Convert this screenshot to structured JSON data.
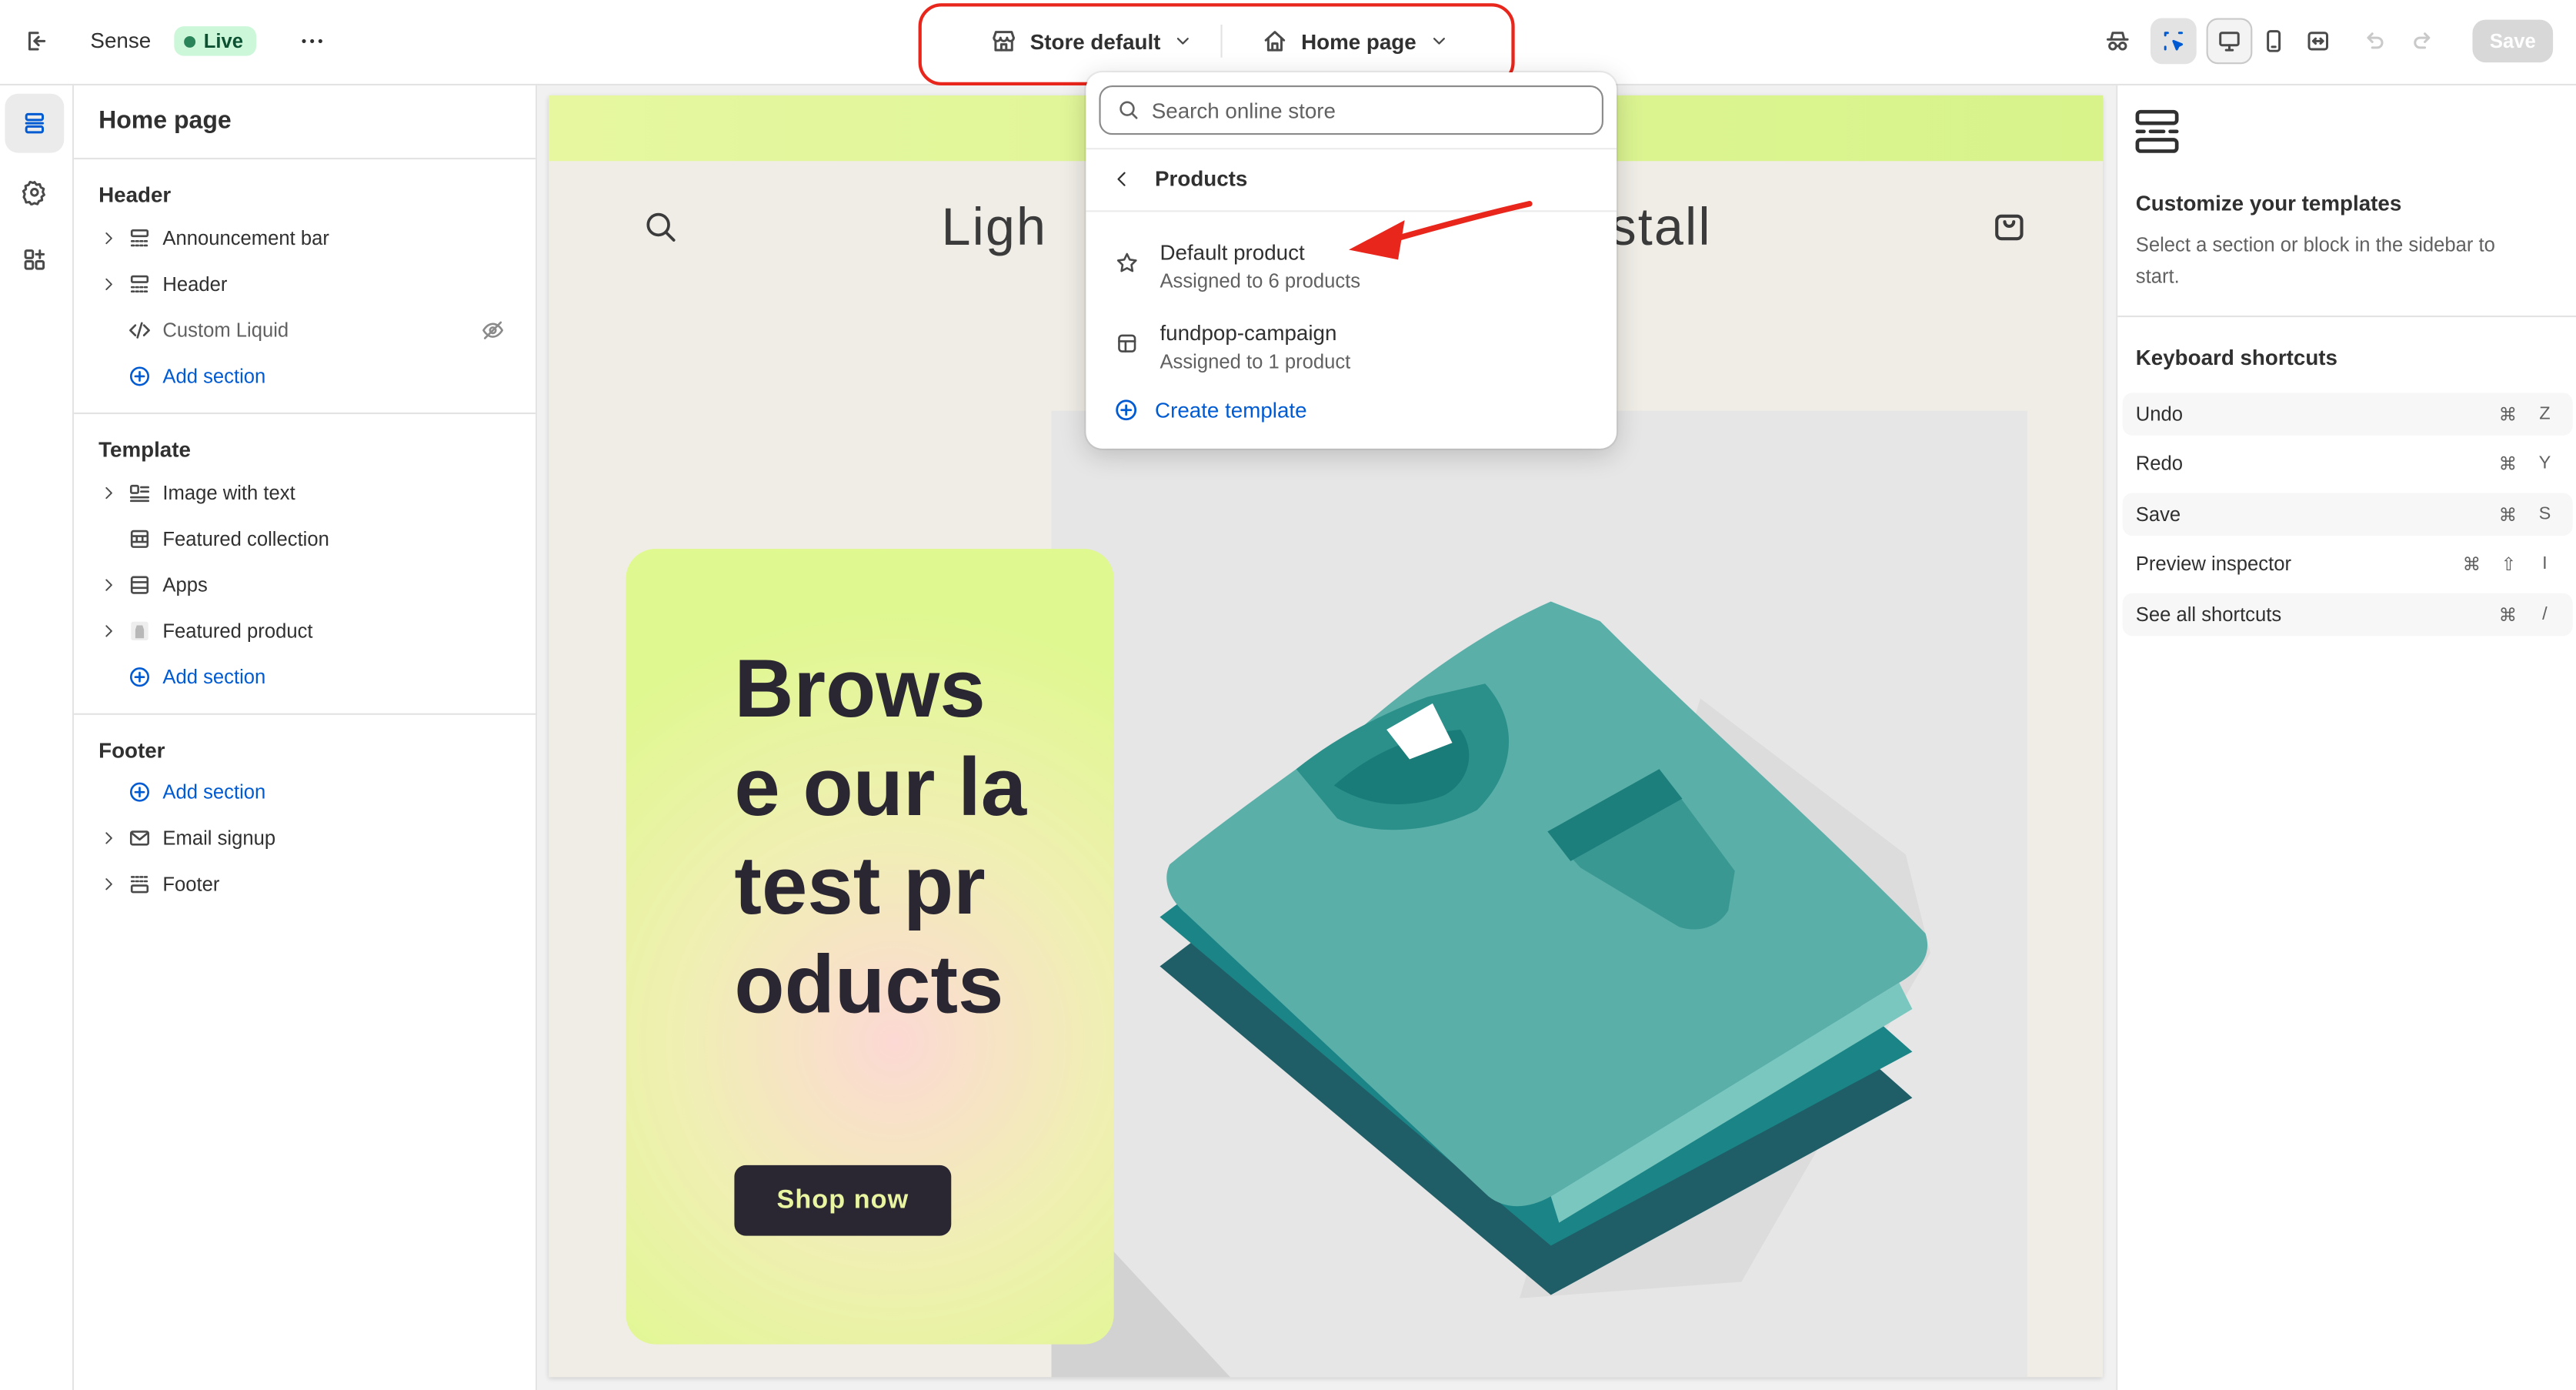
{
  "topbar": {
    "theme_name": "Sense",
    "live_badge": "Live",
    "store_selector": "Store default",
    "page_selector": "Home page",
    "save_label": "Save"
  },
  "sidebar": {
    "title": "Home page",
    "header_group": {
      "label": "Header",
      "items": [
        {
          "label": "Announcement bar",
          "icon": "section-icon"
        },
        {
          "label": "Header",
          "icon": "section-icon"
        },
        {
          "label": "Custom Liquid",
          "icon": "code-icon",
          "hidden": true
        }
      ],
      "add_section": "Add section"
    },
    "template_group": {
      "label": "Template",
      "items": [
        {
          "label": "Image with text",
          "icon": "image-text-icon"
        },
        {
          "label": "Featured collection",
          "icon": "collection-icon"
        },
        {
          "label": "Apps",
          "icon": "apps-section-icon"
        },
        {
          "label": "Featured product",
          "icon": "product-thumbnail-icon"
        }
      ],
      "add_section": "Add section"
    },
    "footer_group": {
      "label": "Footer",
      "add_section": "Add section",
      "items": [
        {
          "label": "Email signup",
          "icon": "email-icon"
        },
        {
          "label": "Footer",
          "icon": "footer-icon"
        }
      ]
    }
  },
  "preview": {
    "store_name_left": "Ligh",
    "store_name_right": "stall",
    "headline": "Browse our latest products",
    "cta": "Shop now"
  },
  "dropdown": {
    "search_placeholder": "Search online store",
    "back_label": "Products",
    "items": [
      {
        "title": "Default product",
        "subtitle": "Assigned to 6 products",
        "icon": "star-icon"
      },
      {
        "title": "fundpop-campaign",
        "subtitle": "Assigned to 1 product",
        "icon": "template-icon"
      }
    ],
    "create_label": "Create template"
  },
  "right_panel": {
    "title": "Customize your templates",
    "description": "Select a section or block in the sidebar to start.",
    "shortcuts_title": "Keyboard shortcuts",
    "shortcuts": [
      {
        "label": "Undo",
        "keys": [
          "⌘",
          "Z"
        ]
      },
      {
        "label": "Redo",
        "keys": [
          "⌘",
          "Y"
        ]
      },
      {
        "label": "Save",
        "keys": [
          "⌘",
          "S"
        ]
      },
      {
        "label": "Preview inspector",
        "keys": [
          "⌘",
          "⇧",
          "I"
        ]
      },
      {
        "label": "See all shortcuts",
        "keys": [
          "⌘",
          "/"
        ]
      }
    ]
  },
  "colors": {
    "accent_blue": "#005bd3",
    "annotation_red": "#e8261c",
    "live_green": "#29845a",
    "cta_bg": "#2b2732",
    "announcement_bar": "#dff88f"
  }
}
